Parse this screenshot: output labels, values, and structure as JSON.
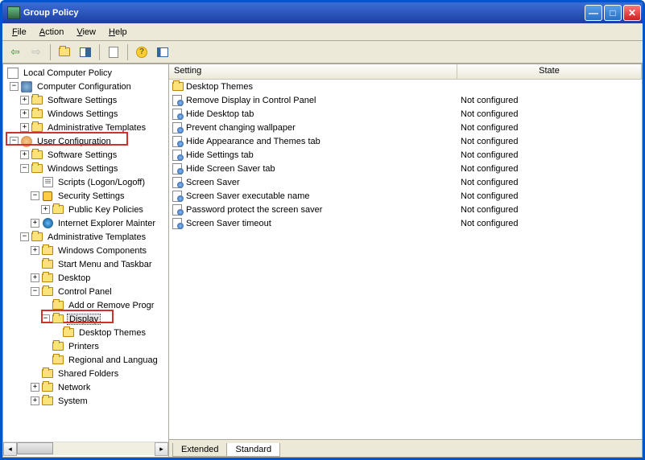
{
  "window": {
    "title": "Group Policy"
  },
  "menu": {
    "file": "File",
    "action": "Action",
    "view": "View",
    "help": "Help"
  },
  "tree": {
    "root": "Local Computer Policy",
    "compconf": "Computer Configuration",
    "cc_software": "Software Settings",
    "cc_windows": "Windows Settings",
    "cc_admin": "Administrative Templates",
    "userconf": "User Configuration",
    "uc_software": "Software Settings",
    "uc_windows": "Windows Settings",
    "scripts": "Scripts (Logon/Logoff)",
    "security": "Security Settings",
    "pubkey": "Public Key Policies",
    "iemaint": "Internet Explorer Mainter",
    "uc_admin": "Administrative Templates",
    "wincomp": "Windows Components",
    "startmenu": "Start Menu and Taskbar",
    "desktop": "Desktop",
    "controlpanel": "Control Panel",
    "addremove": "Add or Remove Progr",
    "display": "Display",
    "deskthemes": "Desktop Themes",
    "printers": "Printers",
    "regional": "Regional and Languag",
    "shared": "Shared Folders",
    "network": "Network",
    "system": "System"
  },
  "list": {
    "headers": {
      "setting": "Setting",
      "state": "State"
    },
    "rows": [
      {
        "type": "folder",
        "name": "Desktop Themes",
        "state": ""
      },
      {
        "type": "setting",
        "name": "Remove Display in Control Panel",
        "state": "Not configured"
      },
      {
        "type": "setting",
        "name": "Hide Desktop tab",
        "state": "Not configured"
      },
      {
        "type": "setting",
        "name": "Prevent changing wallpaper",
        "state": "Not configured"
      },
      {
        "type": "setting",
        "name": "Hide Appearance and Themes tab",
        "state": "Not configured"
      },
      {
        "type": "setting",
        "name": "Hide Settings tab",
        "state": "Not configured"
      },
      {
        "type": "setting",
        "name": "Hide Screen Saver tab",
        "state": "Not configured"
      },
      {
        "type": "setting",
        "name": "Screen Saver",
        "state": "Not configured"
      },
      {
        "type": "setting",
        "name": "Screen Saver executable name",
        "state": "Not configured"
      },
      {
        "type": "setting",
        "name": "Password protect the screen saver",
        "state": "Not configured"
      },
      {
        "type": "setting",
        "name": "Screen Saver timeout",
        "state": "Not configured"
      }
    ]
  },
  "tabs": {
    "extended": "Extended",
    "standard": "Standard"
  }
}
